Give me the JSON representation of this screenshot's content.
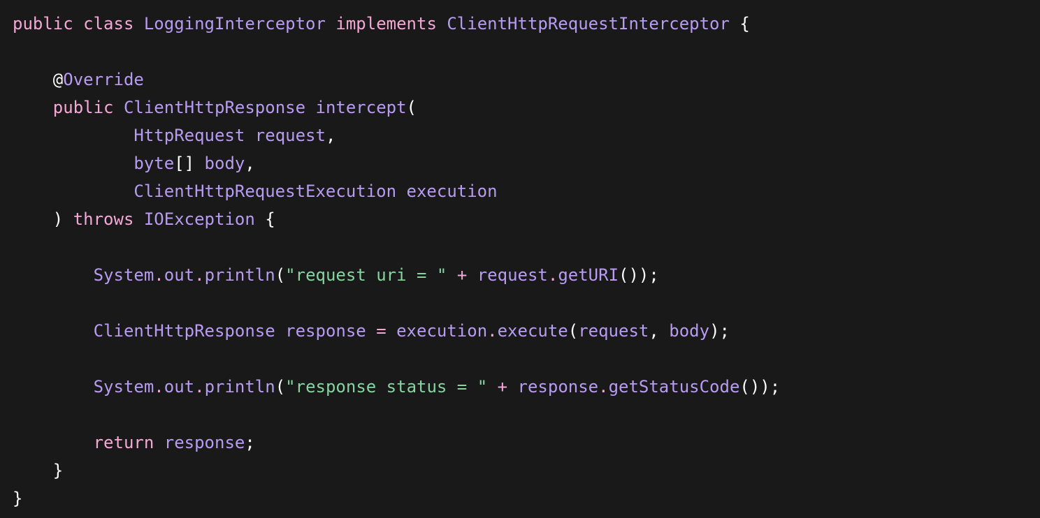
{
  "colors": {
    "background": "#191919",
    "keyword": "#f3a8d6",
    "type": "#b79cf0",
    "function": "#b79cf0",
    "string": "#87d4a0",
    "operator": "#f3a8d6",
    "punctuation": "#ffffff"
  },
  "code": {
    "lines": [
      [
        [
          "kw",
          "public"
        ],
        [
          "ws",
          " "
        ],
        [
          "kw",
          "class"
        ],
        [
          "ws",
          " "
        ],
        [
          "type",
          "LoggingInterceptor"
        ],
        [
          "ws",
          " "
        ],
        [
          "kw",
          "implements"
        ],
        [
          "ws",
          " "
        ],
        [
          "type",
          "ClientHttpRequestInterceptor"
        ],
        [
          "ws",
          " "
        ],
        [
          "p",
          "{"
        ]
      ],
      [],
      [
        [
          "ws",
          "    "
        ],
        [
          "p",
          "@"
        ],
        [
          "type",
          "Override"
        ]
      ],
      [
        [
          "ws",
          "    "
        ],
        [
          "kw",
          "public"
        ],
        [
          "ws",
          " "
        ],
        [
          "type",
          "ClientHttpResponse"
        ],
        [
          "ws",
          " "
        ],
        [
          "fn",
          "intercept"
        ],
        [
          "p",
          "("
        ]
      ],
      [
        [
          "ws",
          "            "
        ],
        [
          "type",
          "HttpRequest"
        ],
        [
          "ws",
          " "
        ],
        [
          "type",
          "request"
        ],
        [
          "p",
          ","
        ]
      ],
      [
        [
          "ws",
          "            "
        ],
        [
          "type",
          "byte"
        ],
        [
          "p",
          "[]"
        ],
        [
          "ws",
          " "
        ],
        [
          "type",
          "body"
        ],
        [
          "p",
          ","
        ]
      ],
      [
        [
          "ws",
          "            "
        ],
        [
          "type",
          "ClientHttpRequestExecution"
        ],
        [
          "ws",
          " "
        ],
        [
          "type",
          "execution"
        ]
      ],
      [
        [
          "ws",
          "    "
        ],
        [
          "p",
          ")"
        ],
        [
          "ws",
          " "
        ],
        [
          "kw",
          "throws"
        ],
        [
          "ws",
          " "
        ],
        [
          "type",
          "IOException"
        ],
        [
          "ws",
          " "
        ],
        [
          "p",
          "{"
        ]
      ],
      [],
      [
        [
          "ws",
          "        "
        ],
        [
          "type",
          "System"
        ],
        [
          "op",
          "."
        ],
        [
          "type",
          "out"
        ],
        [
          "op",
          "."
        ],
        [
          "fn",
          "println"
        ],
        [
          "p",
          "("
        ],
        [
          "str",
          "\"request uri = \""
        ],
        [
          "ws",
          " "
        ],
        [
          "op",
          "+"
        ],
        [
          "ws",
          " "
        ],
        [
          "type",
          "request"
        ],
        [
          "op",
          "."
        ],
        [
          "fn",
          "getURI"
        ],
        [
          "p",
          "());"
        ]
      ],
      [],
      [
        [
          "ws",
          "        "
        ],
        [
          "type",
          "ClientHttpResponse"
        ],
        [
          "ws",
          " "
        ],
        [
          "type",
          "response"
        ],
        [
          "ws",
          " "
        ],
        [
          "op",
          "="
        ],
        [
          "ws",
          " "
        ],
        [
          "type",
          "execution"
        ],
        [
          "op",
          "."
        ],
        [
          "fn",
          "execute"
        ],
        [
          "p",
          "("
        ],
        [
          "type",
          "request"
        ],
        [
          "p",
          ","
        ],
        [
          "ws",
          " "
        ],
        [
          "type",
          "body"
        ],
        [
          "p",
          ");"
        ]
      ],
      [],
      [
        [
          "ws",
          "        "
        ],
        [
          "type",
          "System"
        ],
        [
          "op",
          "."
        ],
        [
          "type",
          "out"
        ],
        [
          "op",
          "."
        ],
        [
          "fn",
          "println"
        ],
        [
          "p",
          "("
        ],
        [
          "str",
          "\"response status = \""
        ],
        [
          "ws",
          " "
        ],
        [
          "op",
          "+"
        ],
        [
          "ws",
          " "
        ],
        [
          "type",
          "response"
        ],
        [
          "op",
          "."
        ],
        [
          "fn",
          "getStatusCode"
        ],
        [
          "p",
          "());"
        ]
      ],
      [],
      [
        [
          "ws",
          "        "
        ],
        [
          "kw",
          "return"
        ],
        [
          "ws",
          " "
        ],
        [
          "type",
          "response"
        ],
        [
          "p",
          ";"
        ]
      ],
      [
        [
          "ws",
          "    "
        ],
        [
          "p",
          "}"
        ]
      ],
      [
        [
          "p",
          "}"
        ]
      ]
    ]
  }
}
